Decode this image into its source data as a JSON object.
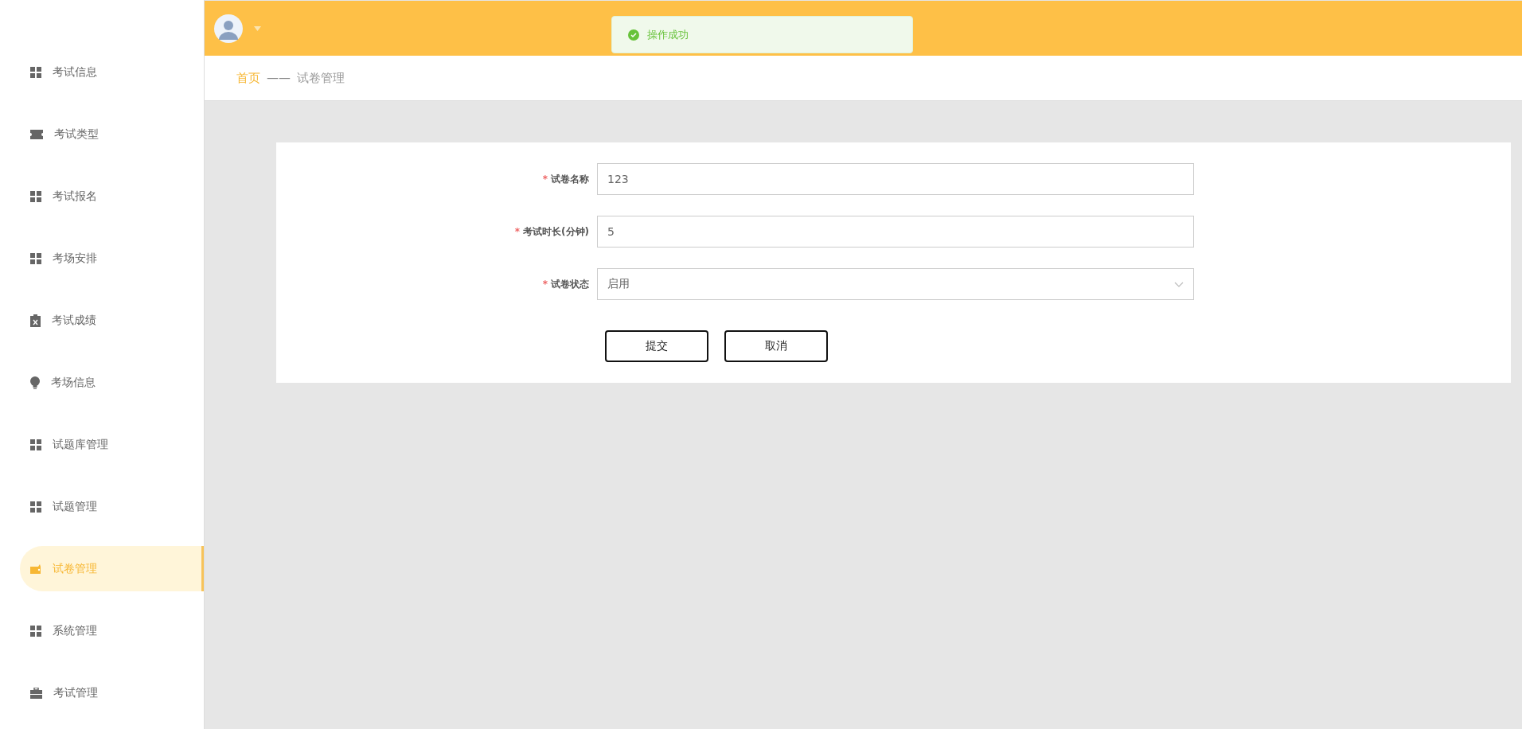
{
  "sidebar": {
    "items": [
      {
        "label": "考试信息",
        "selected": false
      },
      {
        "label": "考试类型",
        "selected": false
      },
      {
        "label": "考试报名",
        "selected": false
      },
      {
        "label": "考场安排",
        "selected": false
      },
      {
        "label": "考试成绩",
        "selected": false
      },
      {
        "label": "考场信息",
        "selected": false
      },
      {
        "label": "试题库管理",
        "selected": false
      },
      {
        "label": "试题管理",
        "selected": false
      },
      {
        "label": "试卷管理",
        "selected": true
      },
      {
        "label": "系统管理",
        "selected": false
      },
      {
        "label": "考试管理",
        "selected": false
      }
    ]
  },
  "toast": {
    "message": "操作成功"
  },
  "breadcrumb": {
    "home": "首页",
    "separator": "——",
    "current": "试卷管理"
  },
  "form": {
    "fields": [
      {
        "kind": "text",
        "required_mark": "*",
        "label": "试卷名称",
        "value": "123"
      },
      {
        "kind": "text",
        "required_mark": "*",
        "label": "考试时长(分钟)",
        "value": "5"
      },
      {
        "kind": "select",
        "required_mark": "*",
        "label": "试卷状态",
        "value": "启用"
      }
    ],
    "buttons": [
      "提交",
      "取消"
    ]
  }
}
